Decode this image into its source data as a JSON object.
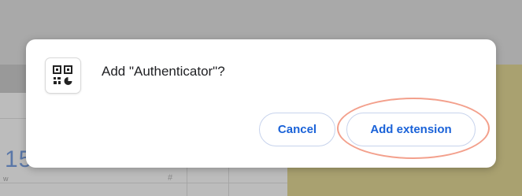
{
  "dialog": {
    "title": "Add \"Authenticator\"?",
    "icon": "qr-code-icon",
    "cancel_label": "Cancel",
    "confirm_label": "Add extension"
  },
  "background": {
    "big_number": "15 ",
    "small_label": "w",
    "hash_label": "#"
  },
  "colors": {
    "accent": "#1a62d8",
    "highlight": "#f3a08c"
  }
}
